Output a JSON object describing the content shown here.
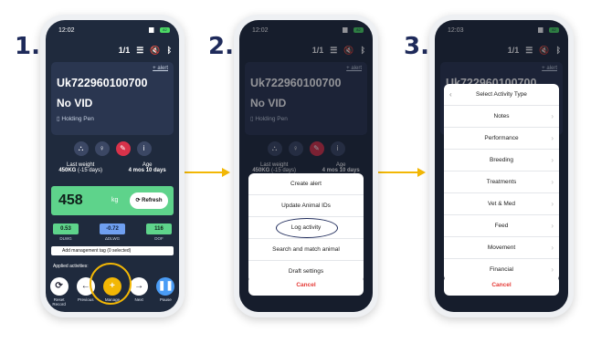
{
  "steps": [
    "1.",
    "2.",
    "3."
  ],
  "status_bar": {
    "times": [
      "12:02",
      "12:02",
      "12:03"
    ],
    "battery": "82"
  },
  "toolbar": {
    "page": "1/1",
    "list": "☰",
    "mute": "🔇",
    "bt": "ᛒ"
  },
  "animal": {
    "alert_label": "+ alert",
    "id": "Uk722960100700",
    "vid": "No VID",
    "location": "Holding Pen"
  },
  "stats": {
    "last_weight_label": "Last weight",
    "last_weight_value": "450KG",
    "last_weight_ago": "(-15 days)",
    "age_label": "Age",
    "age_value": "4 mos 10 days"
  },
  "weigh": {
    "value": "458",
    "unit": "kg",
    "refresh_label": "Refresh"
  },
  "metrics": [
    {
      "value": "0.53",
      "label": "DLWG",
      "color": "#5ed38b",
      "text_color": "#0f1f1a"
    },
    {
      "value": "-0.72",
      "label": "ΔDLWG",
      "color": "#6f9ff0",
      "text_color": "#0f1f3a"
    },
    {
      "value": "116",
      "label": "DOF",
      "color": "#5ed38b",
      "text_color": "#0f1f1a"
    }
  ],
  "tag_row_label": "Add management tag (0 selected)",
  "applied_label": "Applied activities:",
  "bottom_bar": [
    {
      "icon": "⟳",
      "label": "Reset Record"
    },
    {
      "icon": "←",
      "label": "Previous"
    },
    {
      "icon": "+",
      "label": "Manage"
    },
    {
      "icon": "→",
      "label": "Next"
    },
    {
      "icon": "❚❚",
      "label": "Pause"
    }
  ],
  "manage_menu": [
    "Create alert",
    "Update Animal IDs",
    "Log activity",
    "Search and match animal",
    "Draft settings"
  ],
  "cancel_label": "Cancel",
  "activity_type": {
    "title": "Select Activity Type",
    "back": "‹",
    "items": [
      "Notes",
      "Performance",
      "Breeding",
      "Treatments",
      "Vet & Med",
      "Feed",
      "Movement",
      "Financial"
    ]
  },
  "colors": {
    "accent": "#f2b705",
    "navy": "#1e2a5a",
    "green": "#5ed38b",
    "red": "#d8324a"
  }
}
